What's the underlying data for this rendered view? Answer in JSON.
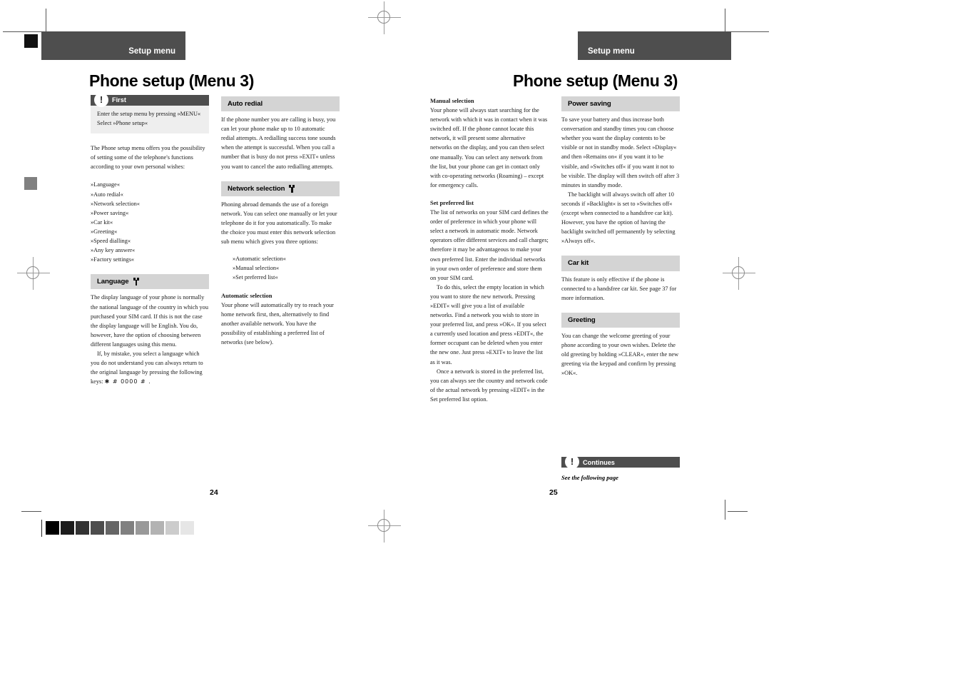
{
  "document": {
    "running_head_left": "Setup menu",
    "running_head_right": "Setup menu",
    "title_left": "Phone setup (Menu 3)",
    "title_right": "Phone setup (Menu 3)",
    "page_number_left": "24",
    "page_number_right": "25"
  },
  "colors": {
    "header_bar": "#4e4e4e",
    "section_heading_bar": "#d4d4d4",
    "note_box_background": "#eeeeee",
    "page_background": "#ffffff",
    "text": "#1a1a1a"
  },
  "calibration_strip": {
    "swatches": [
      "#000000",
      "#1c1c1c",
      "#333333",
      "#4d4d4d",
      "#666666",
      "#808080",
      "#999999",
      "#b3b3b3",
      "#cccccc",
      "#e6e6e6"
    ]
  },
  "col1": {
    "note": {
      "bar_label": "First",
      "icon": "exclamation-icon",
      "line1": "Enter the setup menu by pressing »MENU«",
      "line2": "Select »Phone setup«"
    },
    "intro": "The Phone setup menu offers you the possibility of setting some of the telephone's functions according to your own personal wishes:",
    "menu_items": [
      "»Language«",
      "»Auto redial«",
      "»Network selection«",
      "»Power saving«",
      "»Car kit«",
      "»Greeting«",
      "»Speed dialling«",
      "»Any key answer«",
      "»Factory settings«"
    ],
    "language": {
      "heading": "Language",
      "heading_icon": "sim-card-icon",
      "para1": "The display language of your phone is normally the national language of the country in which you purchased your SIM card. If this is not the case the display language will be English. You do, however, have the option of choosing between different languages using this menu.",
      "para2_prefix": "If, by mistake, you select a language which you do not understand you can always return to the original language by pressing the following keys: ",
      "para2_keys": "✱ # 0000 # ."
    }
  },
  "col2": {
    "auto_redial": {
      "heading": "Auto redial",
      "para1": "If the phone number you are calling is busy, you can let your phone make up to 10 automatic redial attempts. A redialling success tone sounds when the attempt is successful. When you call a number that is busy do not press »EXIT« unless you want to cancel the auto redialling attempts."
    },
    "network_selection": {
      "heading": "Network selection",
      "heading_icon": "sim-card-icon",
      "para1": "Phoning abroad demands the use of a foreign network. You can select one manually or let your telephone do it for you automatically. To make the choice you must enter this network selection sub menu which gives you three options:",
      "options": [
        "»Automatic selection«",
        "»Manual selection«",
        "»Set preferred list«"
      ],
      "automatic_selection_heading": "Automatic selection",
      "automatic_selection_para": "Your phone will automatically try to reach your home network first, then, alternatively to find another available network. You have the possibility of establishing a preferred list of networks (see below)."
    }
  },
  "col3": {
    "manual_selection": {
      "heading": "Manual selection",
      "para1": "Your phone will always start searching for the network with which it was in contact when it was switched off. If the phone cannot locate this network, it will present some alternative networks on the display, and you can then select one manually. You can select any network from the list, but your phone can get in contact only with co-operating networks (Roaming) – except for emergency calls."
    },
    "set_preferred_list": {
      "heading": "Set preferred list",
      "para1": "The list of networks on your SIM card defines the order of preference in which your phone will select a network in automatic mode. Network operators offer different services and call charges; therefore it may be advantageous to make your own preferred list. Enter the individual networks in your own order of preference and store them on your SIM card.",
      "para2": "To do this, select the empty location in which you want to store the new network. Pressing »EDIT« will give you a list of available networks. Find a network you wish to store in your preferred list, and press »OK«. If you select a currently used location and press »EDIT«, the former occupant can be deleted when you enter the new one. Just press »EXIT« to leave the list as it was.",
      "para3": "Once a network is stored in the preferred list, you can always see the country and network code of the actual network by pressing »EDIT« in the Set preferred list option."
    }
  },
  "col4": {
    "power_saving": {
      "heading": "Power saving",
      "para1": "To save your battery and thus increase both conversation and standby times you can choose whether you want the display contents to be visible or not in standby mode. Select »Display« and then »Remains on« if you want it to be visible, and »Switches off« if you want it not to be visible. The display will then switch off after 3 minutes in standby mode.",
      "para2": "The backlight will always switch off after 10 seconds if »Backlight« is set to »Switches off« (except when connected to a handsfree car kit). However, you have the option of having the backlight switched off permanently by selecting »Always off«."
    },
    "car_kit": {
      "heading": "Car kit",
      "para1": "This feature is only effective if the phone is connected to a handsfree car kit. See page 37 for more information."
    },
    "greeting": {
      "heading": "Greeting",
      "para1": "You can change the welcome greeting of your phone according to your own wishes. Delete the old greeting by holding »CLEAR«, enter the new greeting via the keypad and confirm by pressing »OK«."
    },
    "continues": {
      "bar_label": "Continues",
      "icon": "exclamation-icon",
      "caption": "See the following page"
    }
  }
}
